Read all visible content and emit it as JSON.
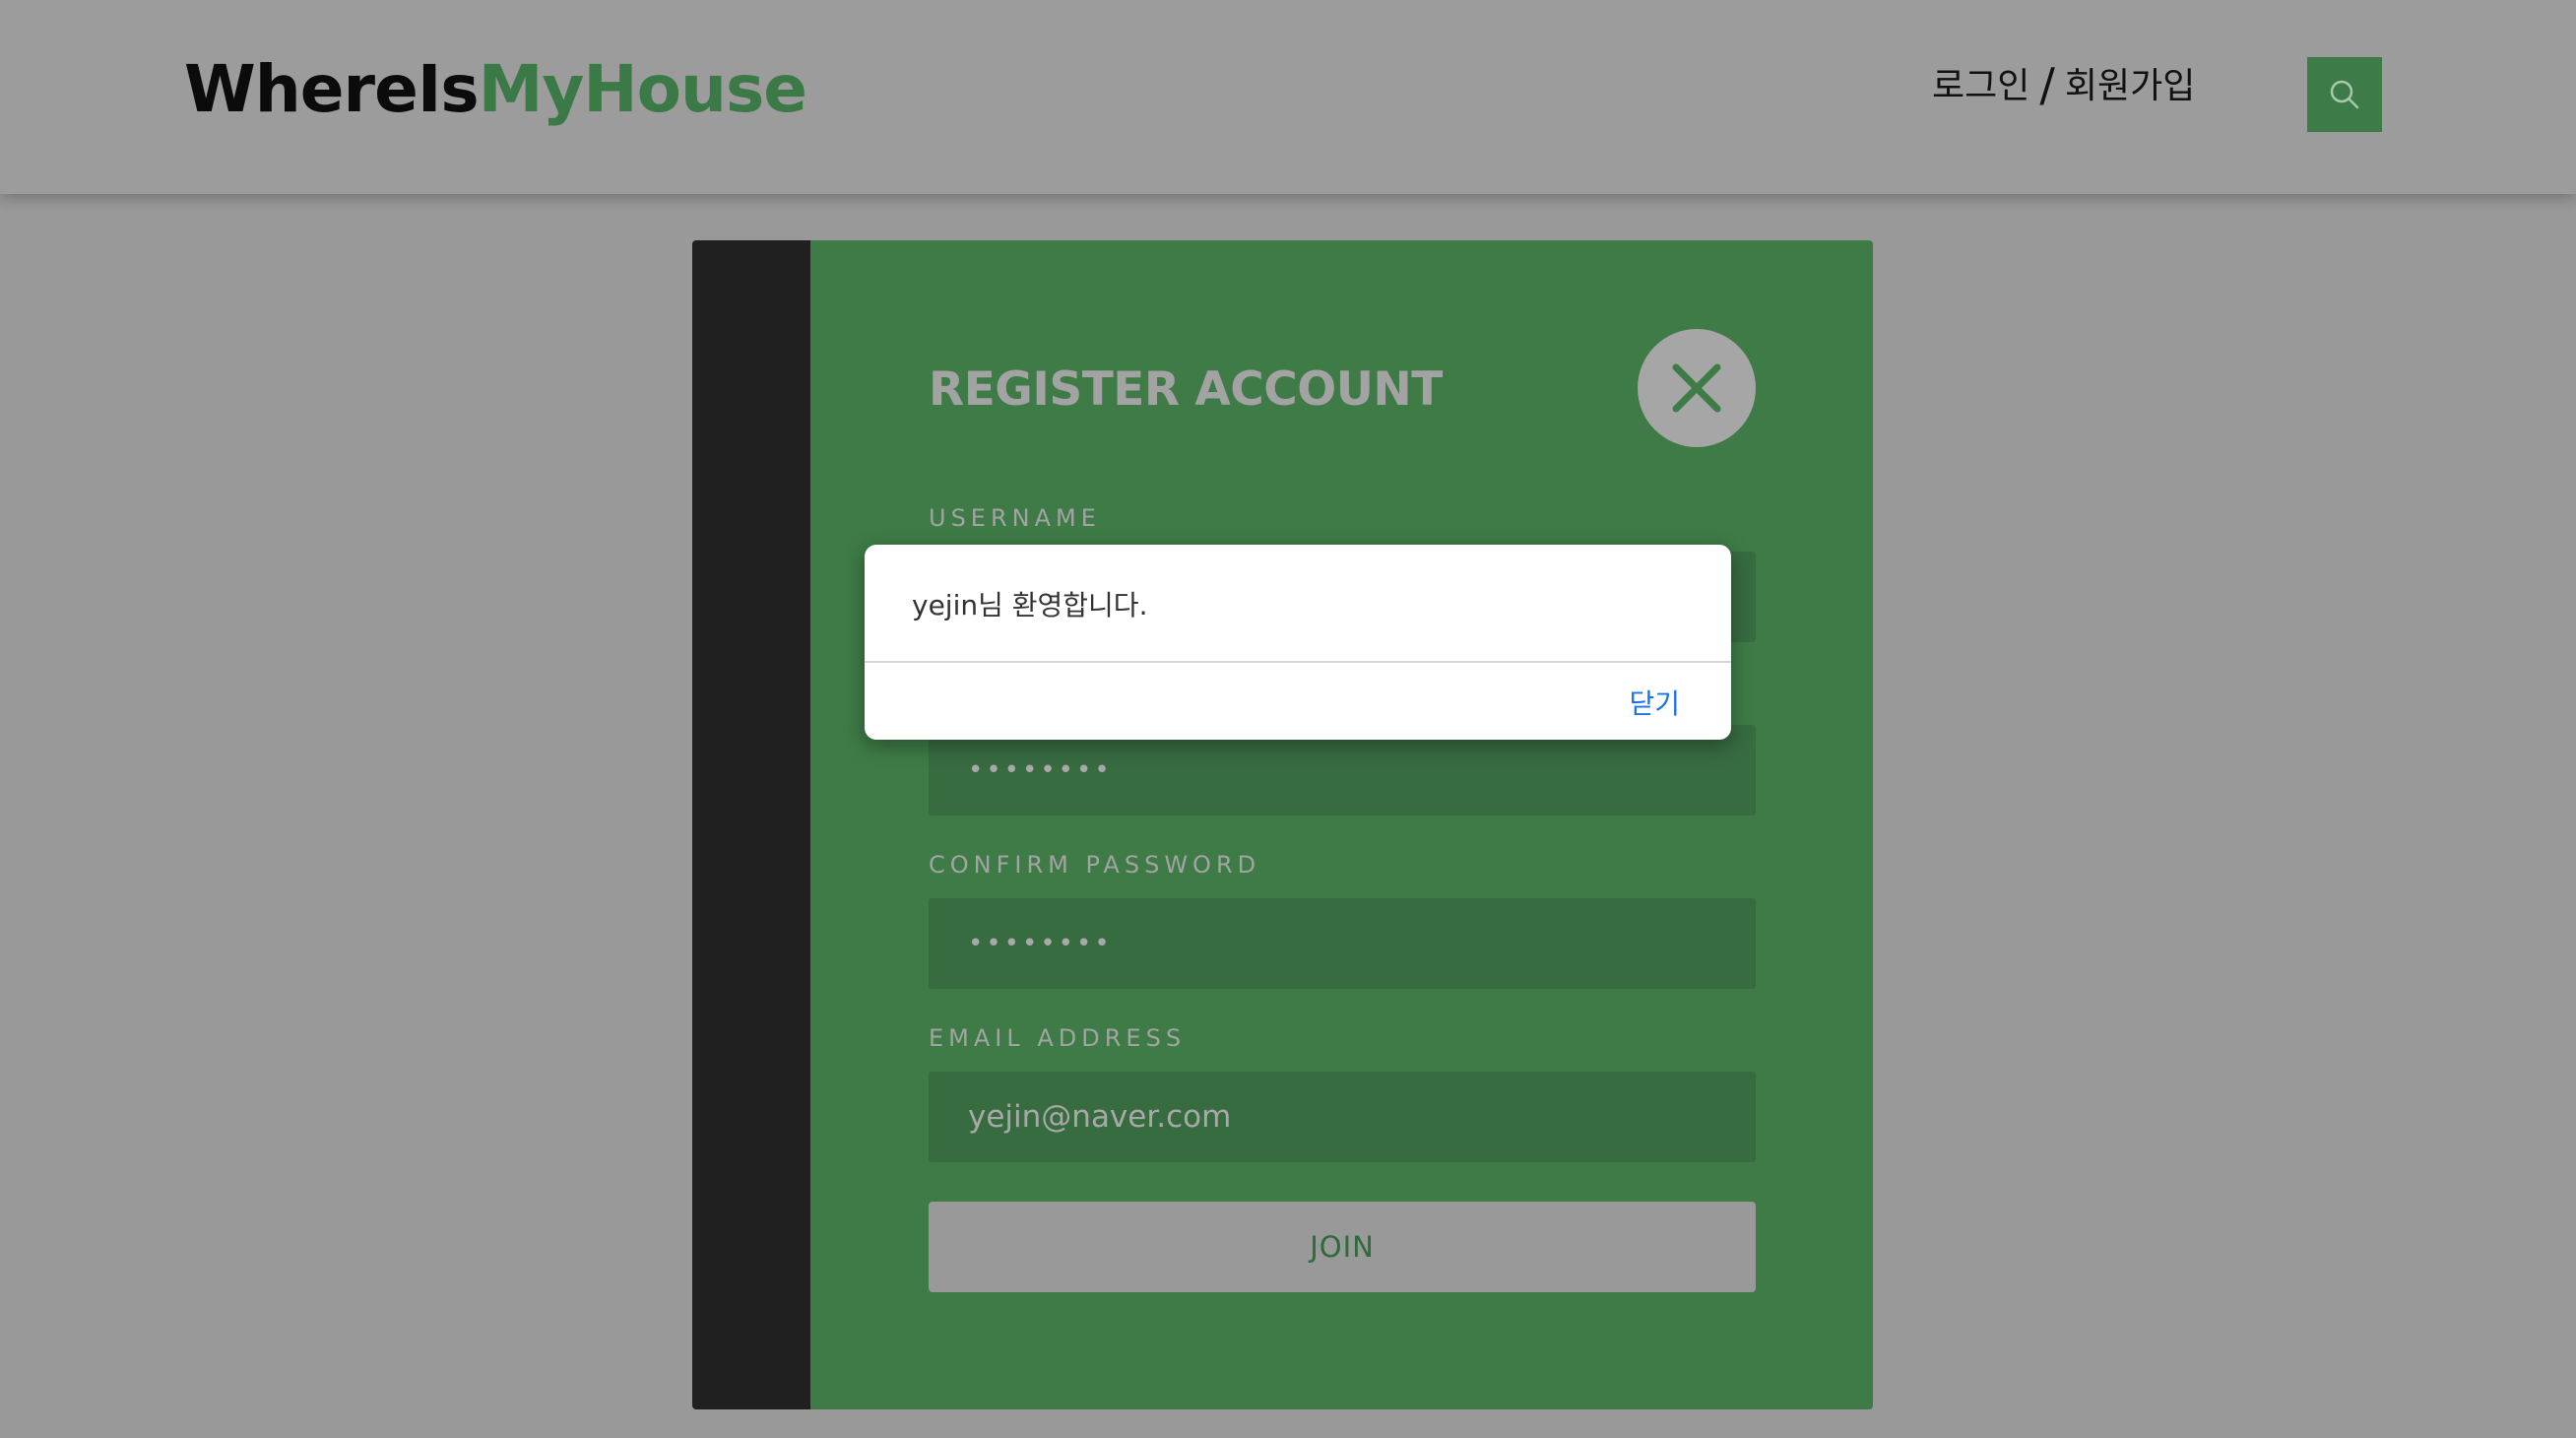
{
  "header": {
    "brand_part1": "WhereIs",
    "brand_part2": "MyHouse",
    "login_label": "로그인",
    "separator": "/",
    "signup_label": "회원가입",
    "search_icon": "search-icon",
    "accent_color": "#3d7b48"
  },
  "register": {
    "title": "REGISTER ACCOUNT",
    "close_icon": "close-icon",
    "username_label": "USERNAME",
    "confirm_password_label": "CONFIRM PASSWORD",
    "password_value": "••••••••",
    "confirm_password_value": "••••••••",
    "email_label": "EMAIL ADDRESS",
    "email_value": "yejin@naver.com",
    "join_label": "JOIN",
    "panel_color": "#3e7b46"
  },
  "alert": {
    "message": "yejin님 환영합니다.",
    "close_label": "닫기",
    "link_color": "#1a73e8"
  }
}
